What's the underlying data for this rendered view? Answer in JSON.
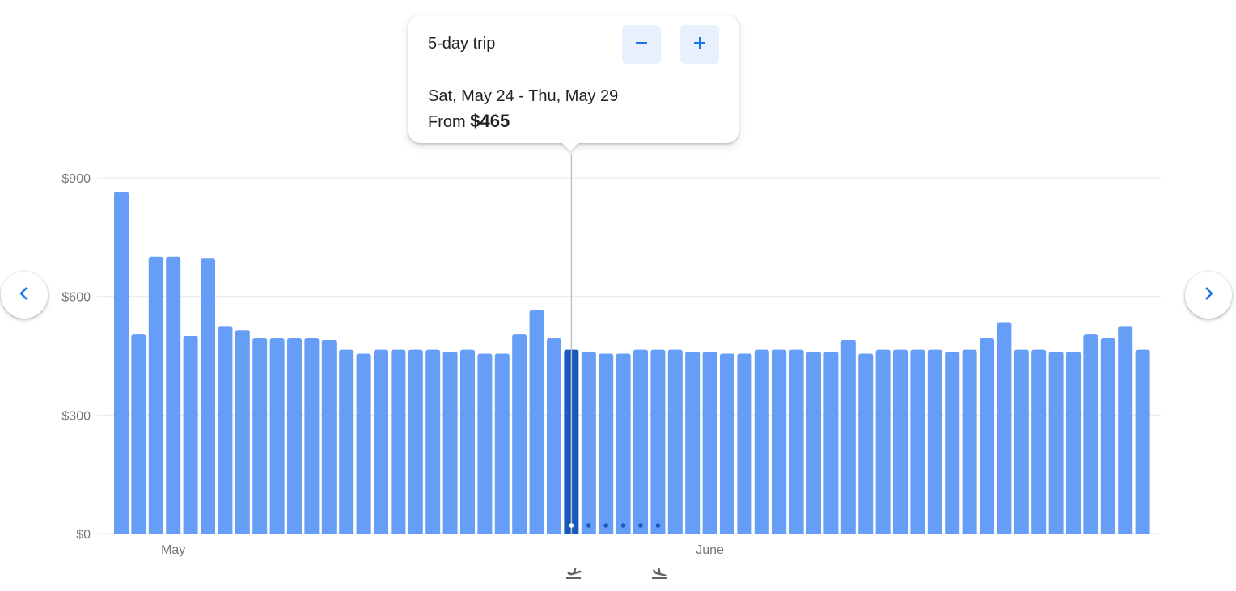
{
  "tooltip": {
    "trip_length": "5-day trip",
    "dates": "Sat, May 24 - Thu, May 29",
    "from_label": "From",
    "price": "$465"
  },
  "icons": {
    "prev": "chevron-left-icon",
    "next": "chevron-right-icon",
    "minus": "minus-icon",
    "plus": "plus-icon",
    "depart": "flight-takeoff-icon",
    "return": "flight-land-icon"
  },
  "colors": {
    "bar": "#669df6",
    "selected_bar": "#185abc",
    "accent": "#1a73e8",
    "grid": "#e8eaed",
    "axis_text": "#70757a"
  },
  "chart_data": {
    "type": "bar",
    "ylim": [
      0,
      900
    ],
    "yticks": [
      {
        "value": 0,
        "label": "$0"
      },
      {
        "value": 300,
        "label": "$300"
      },
      {
        "value": 600,
        "label": "$600"
      },
      {
        "value": 900,
        "label": "$900"
      }
    ],
    "month_labels": [
      {
        "index": 3,
        "label": "May"
      },
      {
        "index": 34,
        "label": "June"
      }
    ],
    "selected_index": 26,
    "trip_length_days": 5,
    "values": [
      865,
      505,
      700,
      700,
      500,
      697,
      525,
      515,
      495,
      495,
      495,
      495,
      490,
      465,
      455,
      465,
      465,
      465,
      465,
      460,
      465,
      455,
      455,
      505,
      565,
      495,
      465,
      460,
      455,
      455,
      465,
      465,
      465,
      460,
      460,
      455,
      455,
      465,
      465,
      465,
      460,
      460,
      490,
      455,
      465,
      465,
      465,
      465,
      460,
      465,
      495,
      535,
      465,
      465,
      460,
      460,
      505,
      495,
      525,
      465
    ]
  }
}
